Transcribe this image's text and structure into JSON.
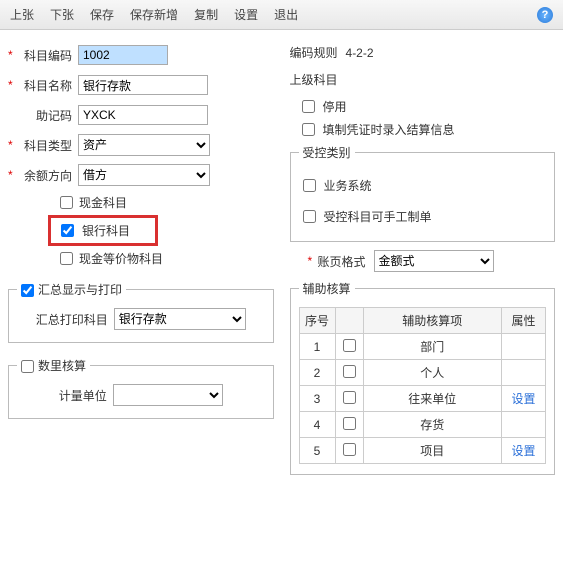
{
  "toolbar": {
    "prev": "上张",
    "next": "下张",
    "save": "保存",
    "saveNew": "保存新增",
    "copy": "复制",
    "settings": "设置",
    "exit": "退出"
  },
  "left": {
    "code_label": "科目编码",
    "code_value": "1002",
    "name_label": "科目名称",
    "name_value": "银行存款",
    "mnemonic_label": "助记码",
    "mnemonic_value": "YXCK",
    "type_label": "科目类型",
    "type_value": "资产",
    "balance_label": "余额方向",
    "balance_value": "借方",
    "cash": "现金科目",
    "bank": "银行科目",
    "equiv": "现金等价物科目",
    "summary_legend": "汇总显示与打印",
    "summary_label": "汇总打印科目",
    "summary_value": "银行存款",
    "qty_legend": "数里核算",
    "qty_label": "计量单位"
  },
  "right": {
    "rule_label": "编码规则",
    "rule_value": "4-2-2",
    "parent_label": "上级科目",
    "disable": "停用",
    "settle": "填制凭证时录入结算信息",
    "ctrl_legend": "受控类别",
    "biz": "业务系统",
    "manual": "受控科目可手工制单",
    "acct_label": "账页格式",
    "acct_value": "金额式",
    "aux_legend": "辅助核算",
    "th_no": "序号",
    "th_cb": "",
    "th_item": "辅助核算项",
    "th_attr": "属性",
    "rows": [
      {
        "no": "1",
        "item": "部门",
        "attr": ""
      },
      {
        "no": "2",
        "item": "个人",
        "attr": ""
      },
      {
        "no": "3",
        "item": "往来单位",
        "attr": "设置"
      },
      {
        "no": "4",
        "item": "存货",
        "attr": ""
      },
      {
        "no": "5",
        "item": "项目",
        "attr": "设置"
      }
    ]
  }
}
